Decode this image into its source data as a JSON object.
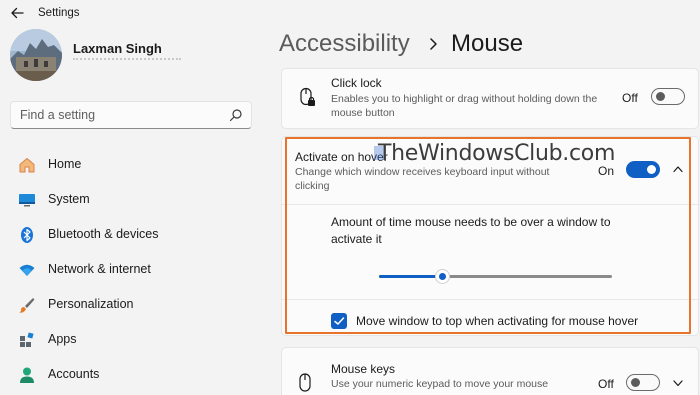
{
  "window": {
    "title": "Settings"
  },
  "profile": {
    "name": "Laxman Singh"
  },
  "search": {
    "placeholder": "Find a setting"
  },
  "nav": {
    "items": [
      {
        "label": "Home",
        "icon": "home-icon"
      },
      {
        "label": "System",
        "icon": "monitor-icon"
      },
      {
        "label": "Bluetooth & devices",
        "icon": "bluetooth-icon"
      },
      {
        "label": "Network & internet",
        "icon": "wifi-icon"
      },
      {
        "label": "Personalization",
        "icon": "brush-icon"
      },
      {
        "label": "Apps",
        "icon": "apps-icon"
      },
      {
        "label": "Accounts",
        "icon": "person-icon"
      }
    ]
  },
  "breadcrumb": {
    "parent": "Accessibility",
    "current": "Mouse"
  },
  "settings": {
    "click_lock": {
      "title": "Click lock",
      "description": "Enables you to highlight or drag without holding down the mouse button",
      "state": "Off"
    },
    "activate_on_hover": {
      "title": "Activate on hover",
      "description": "Change which window receives keyboard input without clicking",
      "state": "On",
      "time_label": "Amount of time mouse needs to be over a window to activate it",
      "slider_value": 0.27,
      "checkbox_label": "Move window to top when activating for mouse hover",
      "checkbox_checked": true
    },
    "mouse_keys": {
      "title": "Mouse keys",
      "description": "Use your numeric keypad to move your mouse",
      "state": "Off"
    }
  },
  "watermark": "TheWindowsClub.com",
  "colors": {
    "accent": "#0f5fc4",
    "highlight_border": "#e8742b"
  }
}
